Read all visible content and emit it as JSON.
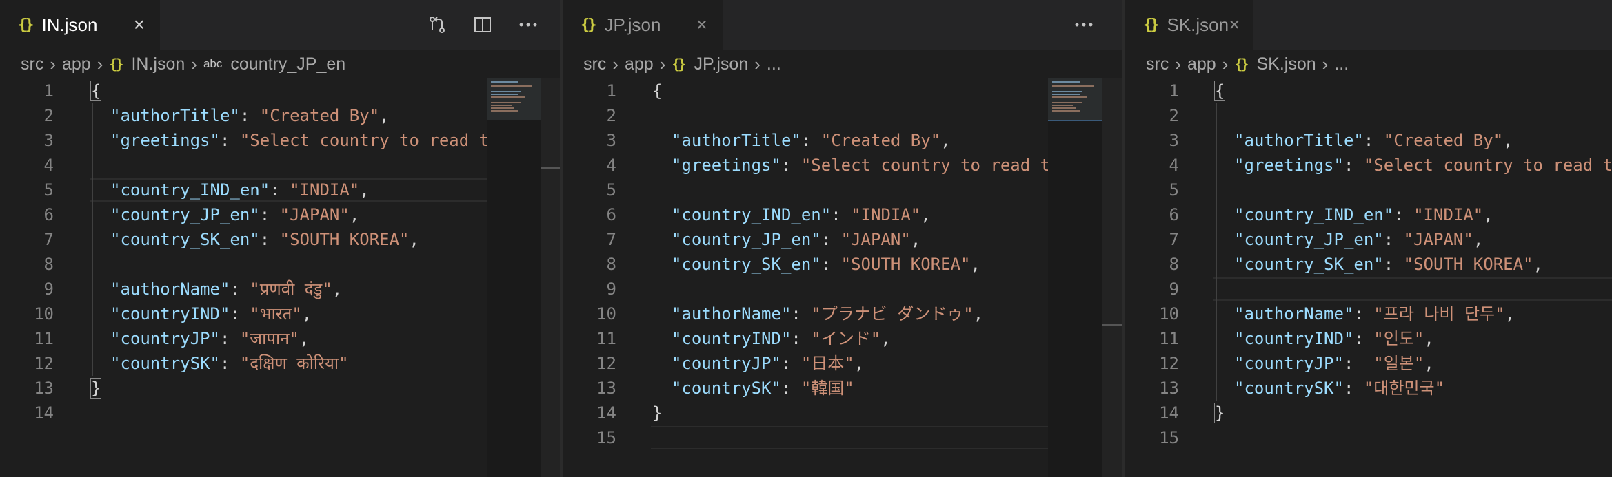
{
  "panes": [
    {
      "tab": {
        "label": "IN.json",
        "close": "×"
      },
      "breadcrumb": {
        "src": "src",
        "app": "app",
        "file": "IN.json",
        "symbol_icon": "abc",
        "symbol": "country_JP_en"
      },
      "actions": [
        "open-changes-icon",
        "split-editor-icon",
        "more-actions-icon"
      ],
      "line_numbers": [
        "1",
        "2",
        "3",
        "4",
        "5",
        "6",
        "7",
        "8",
        "9",
        "10",
        "11",
        "12",
        "13",
        "14"
      ],
      "lines": [
        {
          "open": "{"
        },
        {
          "key": "\"authorTitle\"",
          "val": "\"Created By\"",
          "end": ","
        },
        {
          "key": "\"greetings\"",
          "val": "\"Select country to read t",
          "end": ""
        },
        {},
        {
          "key": "\"country_IND_en\"",
          "val": "\"INDIA\"",
          "end": ","
        },
        {
          "key": "\"country_JP_en\"",
          "val": "\"JAPAN\"",
          "end": ","
        },
        {
          "key": "\"country_SK_en\"",
          "val": "\"SOUTH KOREA\"",
          "end": ","
        },
        {},
        {
          "key": "\"authorName\"",
          "val": "\"प्रणवी दंडु\"",
          "end": ","
        },
        {
          "key": "\"countryIND\"",
          "val": "\"भारत\"",
          "end": ","
        },
        {
          "key": "\"countryJP\"",
          "val": "\"जापान\"",
          "end": ","
        },
        {
          "key": "\"countrySK\"",
          "val": "\"दक्षिण कोरिया\"",
          "end": ""
        },
        {
          "open": "}"
        },
        {}
      ]
    },
    {
      "tab": {
        "label": "JP.json",
        "close": "×"
      },
      "breadcrumb": {
        "src": "src",
        "app": "app",
        "file": "JP.json",
        "ellipsis": "..."
      },
      "actions": [
        "more-actions-icon"
      ],
      "line_numbers": [
        "1",
        "2",
        "3",
        "4",
        "5",
        "6",
        "7",
        "8",
        "9",
        "10",
        "11",
        "12",
        "13",
        "14",
        "15"
      ],
      "lines": [
        {
          "open": "{"
        },
        {},
        {
          "key": "\"authorTitle\"",
          "val": "\"Created By\"",
          "end": ","
        },
        {
          "key": "\"greetings\"",
          "val": "\"Select country to read t",
          "end": ""
        },
        {},
        {
          "key": "\"country_IND_en\"",
          "val": "\"INDIA\"",
          "end": ","
        },
        {
          "key": "\"country_JP_en\"",
          "val": "\"JAPAN\"",
          "end": ","
        },
        {
          "key": "\"country_SK_en\"",
          "val": "\"SOUTH KOREA\"",
          "end": ","
        },
        {},
        {
          "key": "\"authorName\"",
          "val": "\"プラナビ ダンドゥ\"",
          "end": ","
        },
        {
          "key": "\"countryIND\"",
          "val": "\"インド\"",
          "end": ","
        },
        {
          "key": "\"countryJP\"",
          "val": "\"日本\"",
          "end": ","
        },
        {
          "key": "\"countrySK\"",
          "val": "\"韓国\"",
          "end": ""
        },
        {
          "open": "}"
        },
        {}
      ]
    },
    {
      "tab": {
        "label": "SK.json",
        "close": "×"
      },
      "breadcrumb": {
        "src": "src",
        "app": "app",
        "file": "SK.json",
        "ellipsis": "..."
      },
      "actions": [],
      "line_numbers": [
        "1",
        "2",
        "3",
        "4",
        "5",
        "6",
        "7",
        "8",
        "9",
        "10",
        "11",
        "12",
        "13",
        "14",
        "15"
      ],
      "lines": [
        {
          "open": "{"
        },
        {},
        {
          "key": "\"authorTitle\"",
          "val": "\"Created By\"",
          "end": ","
        },
        {
          "key": "\"greetings\"",
          "val": "\"Select country to read t",
          "end": ""
        },
        {},
        {
          "key": "\"country_IND_en\"",
          "val": "\"INDIA\"",
          "end": ","
        },
        {
          "key": "\"country_JP_en\"",
          "val": "\"JAPAN\"",
          "end": ","
        },
        {
          "key": "\"country_SK_en\"",
          "val": "\"SOUTH KOREA\"",
          "end": ","
        },
        {},
        {
          "key": "\"authorName\"",
          "val": "\"프라 나비 단두\"",
          "end": ","
        },
        {
          "key": "\"countryIND\"",
          "val": "\"인도\"",
          "end": ","
        },
        {
          "key": "\"countryJP\"",
          "val": " \"일본\"",
          "end": ","
        },
        {
          "key": "\"countrySK\"",
          "val": "\"대한민국\"",
          "end": ""
        },
        {
          "open": "}"
        },
        {}
      ]
    }
  ],
  "colors": {
    "key": "#9cdcfe",
    "string": "#ce9178",
    "brace_icon": "#cbcb41",
    "background": "#1e1e1e"
  }
}
